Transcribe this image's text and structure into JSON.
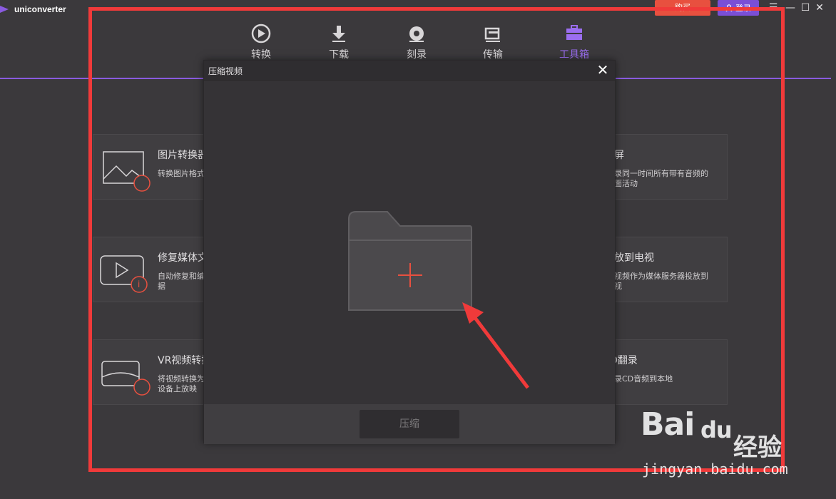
{
  "app": {
    "title": "uniconverter",
    "purchase_label": "购买",
    "login_label": "登录"
  },
  "nav": {
    "items": [
      {
        "label": "转换",
        "icon": "convert-icon"
      },
      {
        "label": "下载",
        "icon": "download-icon"
      },
      {
        "label": "刻录",
        "icon": "burn-icon"
      },
      {
        "label": "传输",
        "icon": "transfer-icon"
      },
      {
        "label": "工具箱",
        "icon": "toolbox-icon",
        "active": true
      }
    ],
    "accent": "#9b6ef0"
  },
  "tools": [
    {
      "title": "图片转换器",
      "desc": "转换图片格式",
      "icon": "image-convert-icon"
    },
    {
      "title": "修复媒体文件",
      "desc": "自动修复和编辑媒体元数据",
      "icon": "fix-media-icon"
    },
    {
      "title": "VR视频转换",
      "desc": "将视频转换为VR视频，在VR设备上放映",
      "icon": "vr-icon"
    },
    {
      "title": "录屏",
      "desc": "录同一时间所有带有音频的画面活动",
      "icon": "screen-record-icon"
    },
    {
      "title": "投放到电视",
      "desc": "视频作为媒体服务器投放到电视",
      "icon": "cast-tv-icon"
    },
    {
      "title": "CD翻录",
      "desc": "录CD音频到本地",
      "icon": "cd-rip-icon"
    }
  ],
  "visible_tool_text": {
    "t1_title": "图片转换器",
    "t1_desc": "转换图片格式",
    "t2_title": "修复媒体文",
    "t2_desc_l1": "自动修复和编",
    "t2_desc_l2": "据",
    "t3_title": "VR视频转换",
    "t3_desc_l1": "将视频转换为",
    "t3_desc_l2": "设备上放映",
    "t4_title": "录屏",
    "t4_desc_l1": "录同一时间所有带有音频的",
    "t4_desc_l2": "面活动",
    "t5_title": "投放到电视",
    "t5_desc_l1": "视频作为媒体服务器投放到",
    "t5_desc_l2": "视",
    "t6_title": "D翻录",
    "t6_desc": "录CD音频到本地"
  },
  "modal": {
    "title": "压缩视频",
    "compress_label": "压缩",
    "add_icon": "add-folder-icon"
  },
  "watermark": {
    "brand": "Bai",
    "brand2": "du",
    "cn": "经验",
    "url": "jingyan.baidu.com"
  },
  "colors": {
    "background": "#3b393c",
    "highlight": "#f03a3a",
    "accent": "#8a5be0",
    "purchase": "#e8503f"
  }
}
